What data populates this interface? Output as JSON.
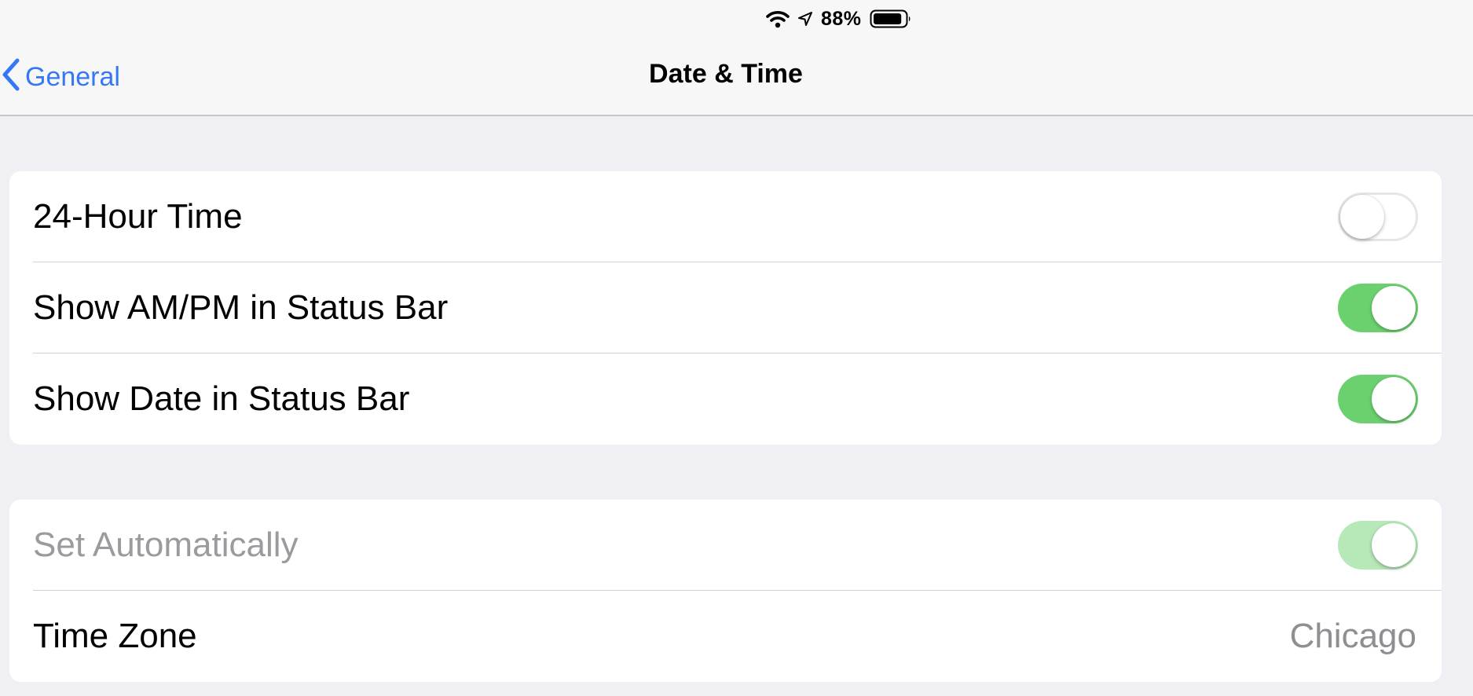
{
  "status_bar": {
    "battery_percent": "88%",
    "icons": [
      "wifi-icon",
      "location-icon",
      "battery-icon"
    ],
    "battery_level": 0.88
  },
  "nav": {
    "back_label": "General",
    "title": "Date & Time",
    "accent_color": "#3478f6"
  },
  "settings": {
    "group1": [
      {
        "label": "24-Hour Time",
        "toggle": false
      },
      {
        "label": "Show AM/PM in Status Bar",
        "toggle": true
      },
      {
        "label": "Show Date in Status Bar",
        "toggle": true
      }
    ],
    "group2": {
      "set_automatically": {
        "label": "Set Automatically",
        "toggle": true,
        "disabled": true
      },
      "time_zone": {
        "label": "Time Zone",
        "value": "Chicago"
      }
    }
  },
  "colors": {
    "toggle_on": "#6bd16f",
    "toggle_on_disabled": "#b6e8b8",
    "background": "#efeff4"
  }
}
